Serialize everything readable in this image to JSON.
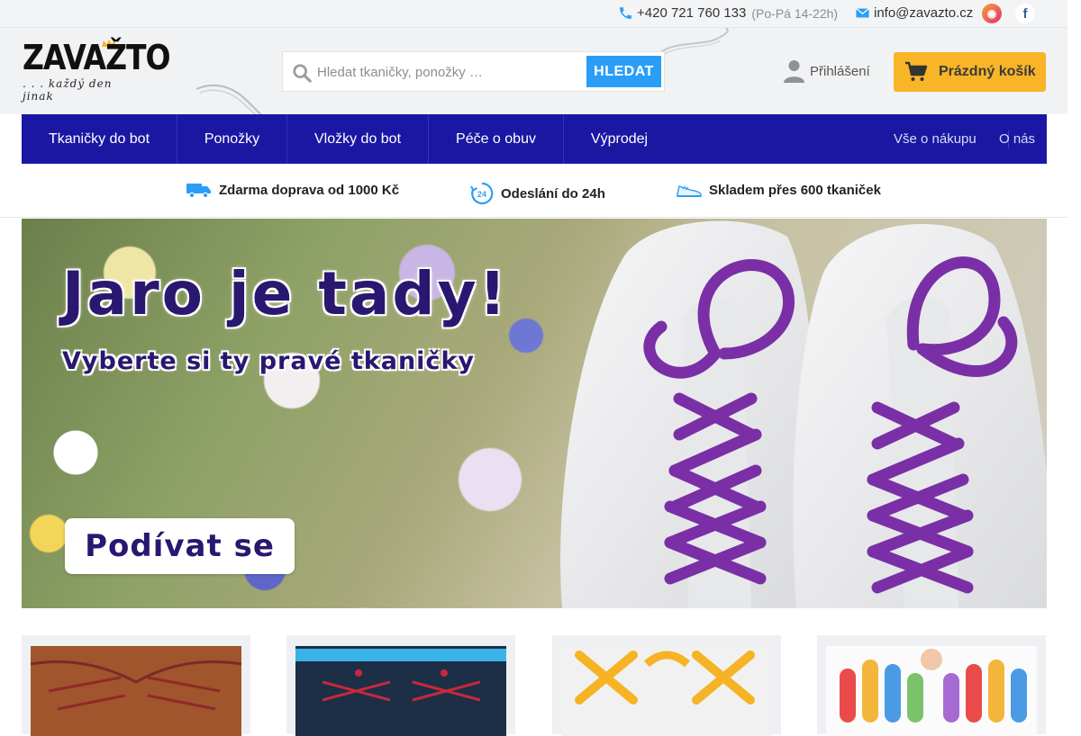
{
  "topbar": {
    "phone": "+420 721 760 133",
    "hours": "(Po-Pá 14-22h)",
    "email": "info@zavazto.cz",
    "icons": [
      "phone-icon",
      "mail-icon",
      "instagram-icon",
      "facebook-icon"
    ]
  },
  "header": {
    "logo_main": "ZAVAŽTO",
    "logo_sub": ". . . každý den jinak",
    "search_placeholder": "Hledat tkaničky, ponožky …",
    "search_button": "HLEDAT",
    "login_label": "Přihlášení",
    "cart_label": "Prázdný košík"
  },
  "nav": {
    "items": [
      "Tkaničky do bot",
      "Ponožky",
      "Vložky do bot",
      "Péče o obuv",
      "Výprodej"
    ],
    "right": [
      "Vše o nákupu",
      "O nás"
    ]
  },
  "usp": [
    {
      "label": "Zdarma doprava od 1000 Kč",
      "icon": "truck-icon"
    },
    {
      "label": "Odeslání do 24h",
      "icon": "clock-24-icon"
    },
    {
      "label": "Skladem přes 600 tkaniček",
      "icon": "shoe-icon"
    }
  ],
  "banner": {
    "title": "Jaro je tady!",
    "subtitle": "Vyberte si ty pravé tkaničky",
    "cta": "Podívat se"
  },
  "colors": {
    "nav_bg": "#1a18a3",
    "search_button": "#2a9ef7",
    "cart_button": "#f8b527",
    "banner_text": "#2a1770",
    "lace_purple": "#7a2fa6"
  }
}
